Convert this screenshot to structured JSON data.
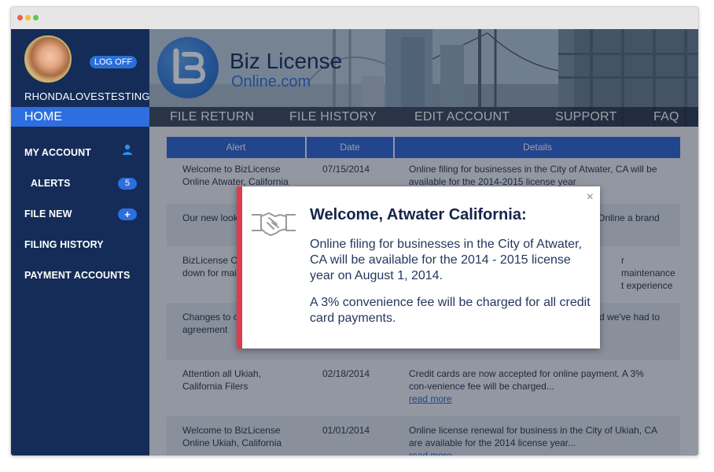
{
  "sidebar": {
    "username": "RHONDALOVESTESTING",
    "logoff_label": "LOG OFF",
    "home_label": "HOME",
    "items": [
      {
        "label": "MY ACCOUNT"
      },
      {
        "label": "ALERTS",
        "badge": "5"
      },
      {
        "label": "FILE NEW",
        "badge": "+"
      },
      {
        "label": "FILING HISTORY"
      },
      {
        "label": "PAYMENT ACCOUNTS"
      }
    ]
  },
  "header": {
    "brand_title": "Biz License",
    "brand_subtitle": "Online.com",
    "nav": [
      "FILE RETURN",
      "FILE HISTORY",
      "EDIT ACCOUNT",
      "SUPPORT",
      "FAQ"
    ]
  },
  "table": {
    "columns": [
      "Alert",
      "Date",
      "Details"
    ],
    "rows": [
      {
        "alert": "Welcome to BizLicense Online Atwater, California",
        "date": "07/15/2014",
        "details": "Online filing for businesses in the City of Atwater, CA will be available for the 2014-2015 license year"
      },
      {
        "alert": "Our new look",
        "date": "",
        "details": "Online a brand"
      },
      {
        "alert": "BizLicense On down for main",
        "date": "",
        "details": "r maintenance t experience"
      },
      {
        "alert": "Changes to or agreement",
        "date": "",
        "details": "d we've had to"
      },
      {
        "alert": "Attention all Ukiah, California Filers",
        "date": "02/18/2014",
        "details": "Credit cards are now accepted for online payment. A 3% con-venience fee will be charged...",
        "link": "read more"
      },
      {
        "alert": "Welcome to BizLicense Online Ukiah, California",
        "date": "01/01/2014",
        "details": "Online license renewal for business in the City of Ukiah, CA are available for the 2014 license year...",
        "link": "read more"
      }
    ]
  },
  "modal": {
    "close": "×",
    "title": "Welcome, Atwater California:",
    "paragraph1": "Online filing for businesses in the City of Atwater, CA will be available for the 2014 - 2015 license year on August 1, 2014.",
    "paragraph2": "A 3% convenience fee will be charged for all credit card payments."
  },
  "colors": {
    "sidebar_bg": "#142c57",
    "accent_blue": "#2d6fe0",
    "modal_accent_red": "#e03b4e"
  },
  "icons": [
    "user-icon",
    "handshake-icon",
    "close-icon",
    "plus-icon",
    "brand-logo-icon"
  ]
}
